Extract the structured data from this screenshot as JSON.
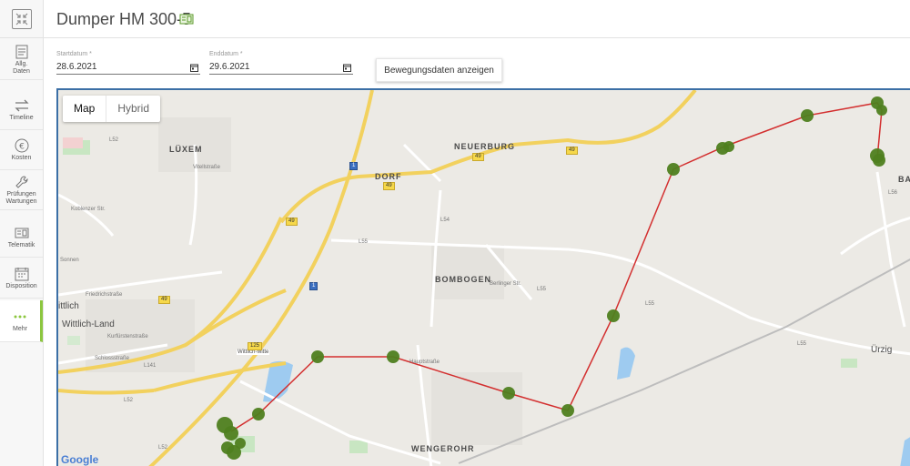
{
  "sidebar": {
    "items": [
      {
        "label": "Allg.\nDaten",
        "icon": "document-icon"
      },
      {
        "label": "Timeline",
        "icon": "timeline-icon"
      },
      {
        "label": "Kosten",
        "icon": "euro-icon"
      },
      {
        "label": "Prüfungen\nWartungen",
        "icon": "wrench-icon"
      },
      {
        "label": "Telematik",
        "icon": "telematics-icon"
      },
      {
        "label": "Disposition",
        "icon": "calendar-icon"
      },
      {
        "label": "Mehr",
        "icon": "more-icon"
      }
    ]
  },
  "header": {
    "title": "Dumper HM 300-5"
  },
  "filters": {
    "start_label": "Startdatum *",
    "start_value": "28.6.2021",
    "end_label": "Enddatum *",
    "end_value": "29.6.2021",
    "show_button": "Bewegungsdaten anzeigen"
  },
  "map": {
    "toggle_map": "Map",
    "toggle_hybrid": "Hybrid",
    "places": {
      "luxem": "LÜXEM",
      "neuerburg": "NEUERBURG",
      "dorf": "DORF",
      "bombogen": "BOMBOGEN",
      "wittlich_land": "Wittlich-Land",
      "wittlich": "ittlich",
      "wengerohr": "WENGEROHR",
      "urzig": "Ürzig",
      "ba": "BA",
      "wittlich_mitte": "Wittlich-Mitte"
    },
    "streets": {
      "l52a": "L52",
      "l52b": "L52",
      "l52c": "L52",
      "l55a": "L55",
      "l55b": "L55",
      "l55c": "L55",
      "l55d": "L55",
      "l141": "L141",
      "l54": "L54",
      "l56": "L56",
      "friedrich": "Friedrichstraße",
      "berlinger": "Berlinger Str.",
      "kurfuersten": "Kurfürstenstraße",
      "schloss": "Schlossstraße",
      "vitell": "Vitellstraße",
      "kobenzer": "Koblenzer Str.",
      "hauptstr": "Hauptstraße",
      "sonnen": "Sonnen"
    },
    "shields": {
      "s49a": "49",
      "s49b": "49",
      "s49c": "49",
      "s49d": "49",
      "s49e": "49",
      "s1a": "1",
      "s1b": "1",
      "s125": "125"
    },
    "attribution": "Google",
    "route_color": "#d32f2f",
    "marker_color": "#4f7f1f"
  }
}
